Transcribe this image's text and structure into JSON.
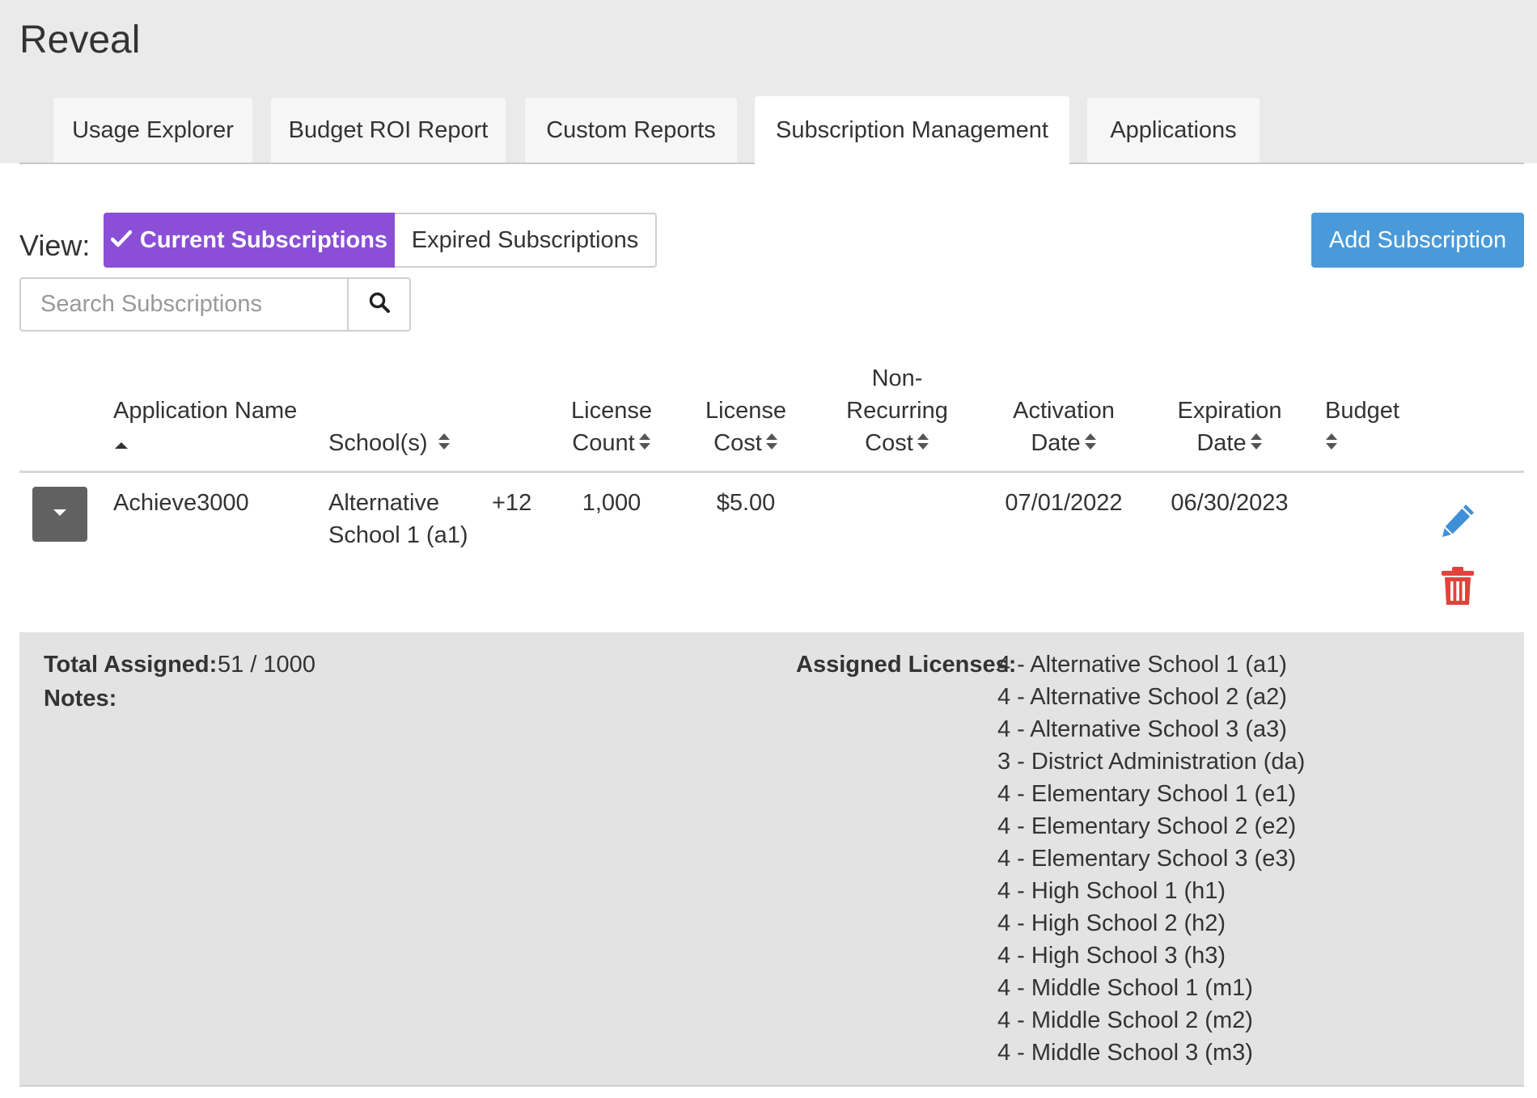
{
  "app": {
    "title": "Reveal"
  },
  "tabs": [
    {
      "label": "Usage Explorer",
      "active": false
    },
    {
      "label": "Budget ROI Report",
      "active": false
    },
    {
      "label": "Custom Reports",
      "active": false
    },
    {
      "label": "Subscription Management",
      "active": true
    },
    {
      "label": "Applications",
      "active": false
    }
  ],
  "view": {
    "label": "View:",
    "current_label": "Current Subscriptions",
    "expired_label": "Expired Subscriptions",
    "selected": "current"
  },
  "add_button": {
    "label": "Add Subscription"
  },
  "search": {
    "placeholder": "Search Subscriptions",
    "value": ""
  },
  "table": {
    "headers": {
      "app_name": "Application Name",
      "schools": "School(s)",
      "license_count_1": "License",
      "license_count_2": "Count",
      "license_cost_1": "License",
      "license_cost_2": "Cost",
      "nonrec_1": "Non-",
      "nonrec_2": "Recurring",
      "nonrec_3": "Cost",
      "activation_1": "Activation",
      "activation_2": "Date",
      "expiration_1": "Expiration",
      "expiration_2": "Date",
      "budget": "Budget"
    },
    "rows": [
      {
        "app_name": "Achieve3000",
        "school_line1": "Alternative",
        "school_line2": "School 1 (a1)",
        "school_more": "+12",
        "license_count": "1,000",
        "license_cost": "$5.00",
        "non_recurring_cost": "",
        "activation_date": "07/01/2022",
        "expiration_date": "06/30/2023",
        "budget": ""
      }
    ]
  },
  "detail": {
    "total_assigned_label": "Total Assigned:",
    "total_assigned_value": "51 / 1000",
    "notes_label": "Notes:",
    "notes_value": "",
    "assigned_licenses_label": "Assigned Licenses:",
    "assigned_licenses": [
      "4 - Alternative School 1 (a1)",
      "4 - Alternative School 2 (a2)",
      "4 - Alternative School 3 (a3)",
      "3 - District Administration (da)",
      "4 - Elementary School 1 (e1)",
      "4 - Elementary School 2 (e2)",
      "4 - Elementary School 3 (e3)",
      "4 - High School 1 (h1)",
      "4 - High School 2 (h2)",
      "4 - High School 3 (h3)",
      "4 - Middle School 1 (m1)",
      "4 - Middle School 2 (m2)",
      "4 - Middle School 3 (m3)"
    ]
  },
  "colors": {
    "accent_purple": "#8a4fd6",
    "add_button_blue": "#4a9ad9",
    "edit_icon_blue": "#3f8fd8",
    "delete_icon_red": "#e0433b"
  },
  "icons": {
    "check": "check-icon",
    "search": "search-icon",
    "sort": "sort-icon",
    "expand": "caret-down-icon",
    "edit": "pencil-icon",
    "delete": "trash-icon"
  }
}
